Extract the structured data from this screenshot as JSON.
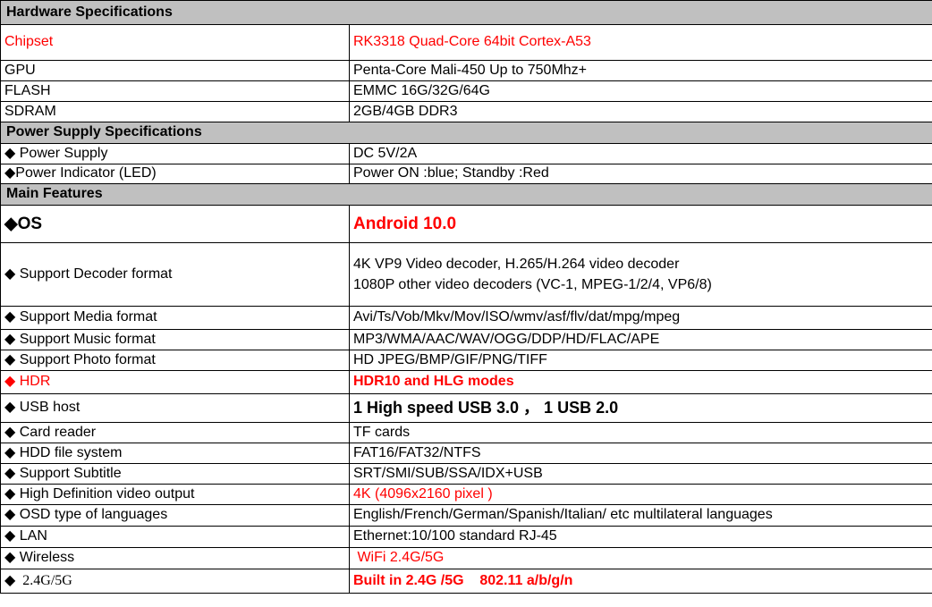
{
  "hardware": {
    "heading": "Hardware Specifications",
    "rows": [
      {
        "label": "Chipset",
        "value": "RK3318 Quad-Core 64bit Cortex-A53"
      },
      {
        "label": "GPU",
        "value": "Penta-Core Mali-450 Up to 750Mhz+"
      },
      {
        "label": "FLASH",
        "value": "EMMC 16G/32G/64G"
      },
      {
        "label": "SDRAM",
        "value": "2GB/4GB DDR3"
      }
    ]
  },
  "power": {
    "heading": "Power Supply Specifications",
    "rows": [
      {
        "label": "◆ Power Supply",
        "value": "DC 5V/2A"
      },
      {
        "label": "◆Power Indicator (LED)",
        "value": "Power ON :blue; Standby :Red"
      }
    ]
  },
  "features": {
    "heading": "Main Features",
    "rows": [
      {
        "label": "◆OS",
        "value": "Android 10.0"
      },
      {
        "label": "◆ Support Decoder format",
        "value_line1": "4K VP9 Video decoder,  H.265/H.264 video decoder",
        "value_line2": "1080P other video decoders (VC-1, MPEG-1/2/4, VP6/8)"
      },
      {
        "label": "◆ Support Media format",
        "value": "Avi/Ts/Vob/Mkv/Mov/ISO/wmv/asf/flv/dat/mpg/mpeg"
      },
      {
        "label": "◆ Support Music format",
        "value": "MP3/WMA/AAC/WAV/OGG/DDP/HD/FLAC/APE"
      },
      {
        "label": "◆ Support Photo format",
        "value": "HD JPEG/BMP/GIF/PNG/TIFF"
      },
      {
        "label": "◆ HDR",
        "value": "HDR10 and HLG modes"
      },
      {
        "label": "◆ USB host",
        "value": "1 High speed USB 3.0 ， 1 USB 2.0"
      },
      {
        "label": "◆ Card reader",
        "value": "TF cards"
      },
      {
        "label": "◆ HDD file system",
        "value": "FAT16/FAT32/NTFS"
      },
      {
        "label": "◆ Support Subtitle",
        "value": "SRT/SMI/SUB/SSA/IDX+USB"
      },
      {
        "label": "◆ High Definition video output",
        "value": "4K (4096x2160 pixel )"
      },
      {
        "label": "◆ OSD type of languages",
        "value": "English/French/German/Spanish/Italian/ etc multilateral languages"
      },
      {
        "label": "◆ LAN",
        "value": "Ethernet:10/100 standard RJ-45"
      },
      {
        "label": "◆ Wireless",
        "value": " WiFi 2.4G/5G"
      },
      {
        "label": "◆  2.4G/5G",
        "value": "Built in 2.4G /5G    802.11 a/b/g/n"
      }
    ]
  }
}
